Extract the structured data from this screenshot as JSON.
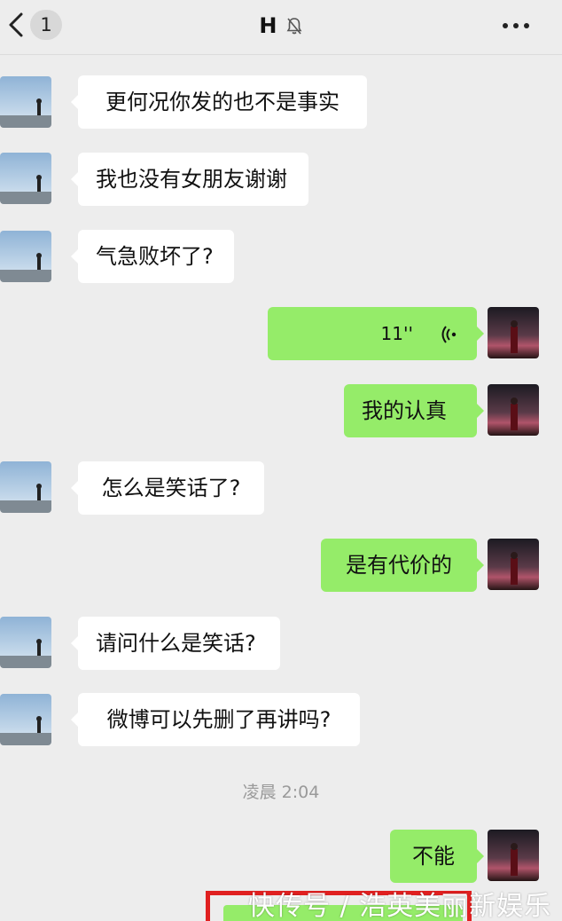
{
  "header": {
    "unread_count": "1",
    "title": "H",
    "mute_icon": "bell-muted-icon",
    "more_icon": "more-dots-icon",
    "back_icon": "chevron-left-icon"
  },
  "colors": {
    "background": "#ededed",
    "left_bubble": "#ffffff",
    "right_bubble": "#95ec69",
    "timestamp": "#9a9a9a",
    "highlight": "#e02020"
  },
  "messages": [
    {
      "side": "left",
      "text": "更何况你发的也不是事实"
    },
    {
      "side": "left",
      "text": "我也没有女朋友谢谢"
    },
    {
      "side": "left",
      "text": "气急败坏了?"
    },
    {
      "side": "right",
      "type": "voice",
      "duration": "11''"
    },
    {
      "side": "right",
      "text": "我的认真"
    },
    {
      "side": "left",
      "text": "怎么是笑话了?"
    },
    {
      "side": "right",
      "text": "是有代价的"
    },
    {
      "side": "left",
      "text": "请问什么是笑话?"
    },
    {
      "side": "left",
      "text": "微博可以先删了再讲吗?"
    },
    {
      "side": "right",
      "text": "不能"
    }
  ],
  "timestamp": "凌晨 2:04",
  "watermark": "快传号 / 浩英美丽新娱乐"
}
